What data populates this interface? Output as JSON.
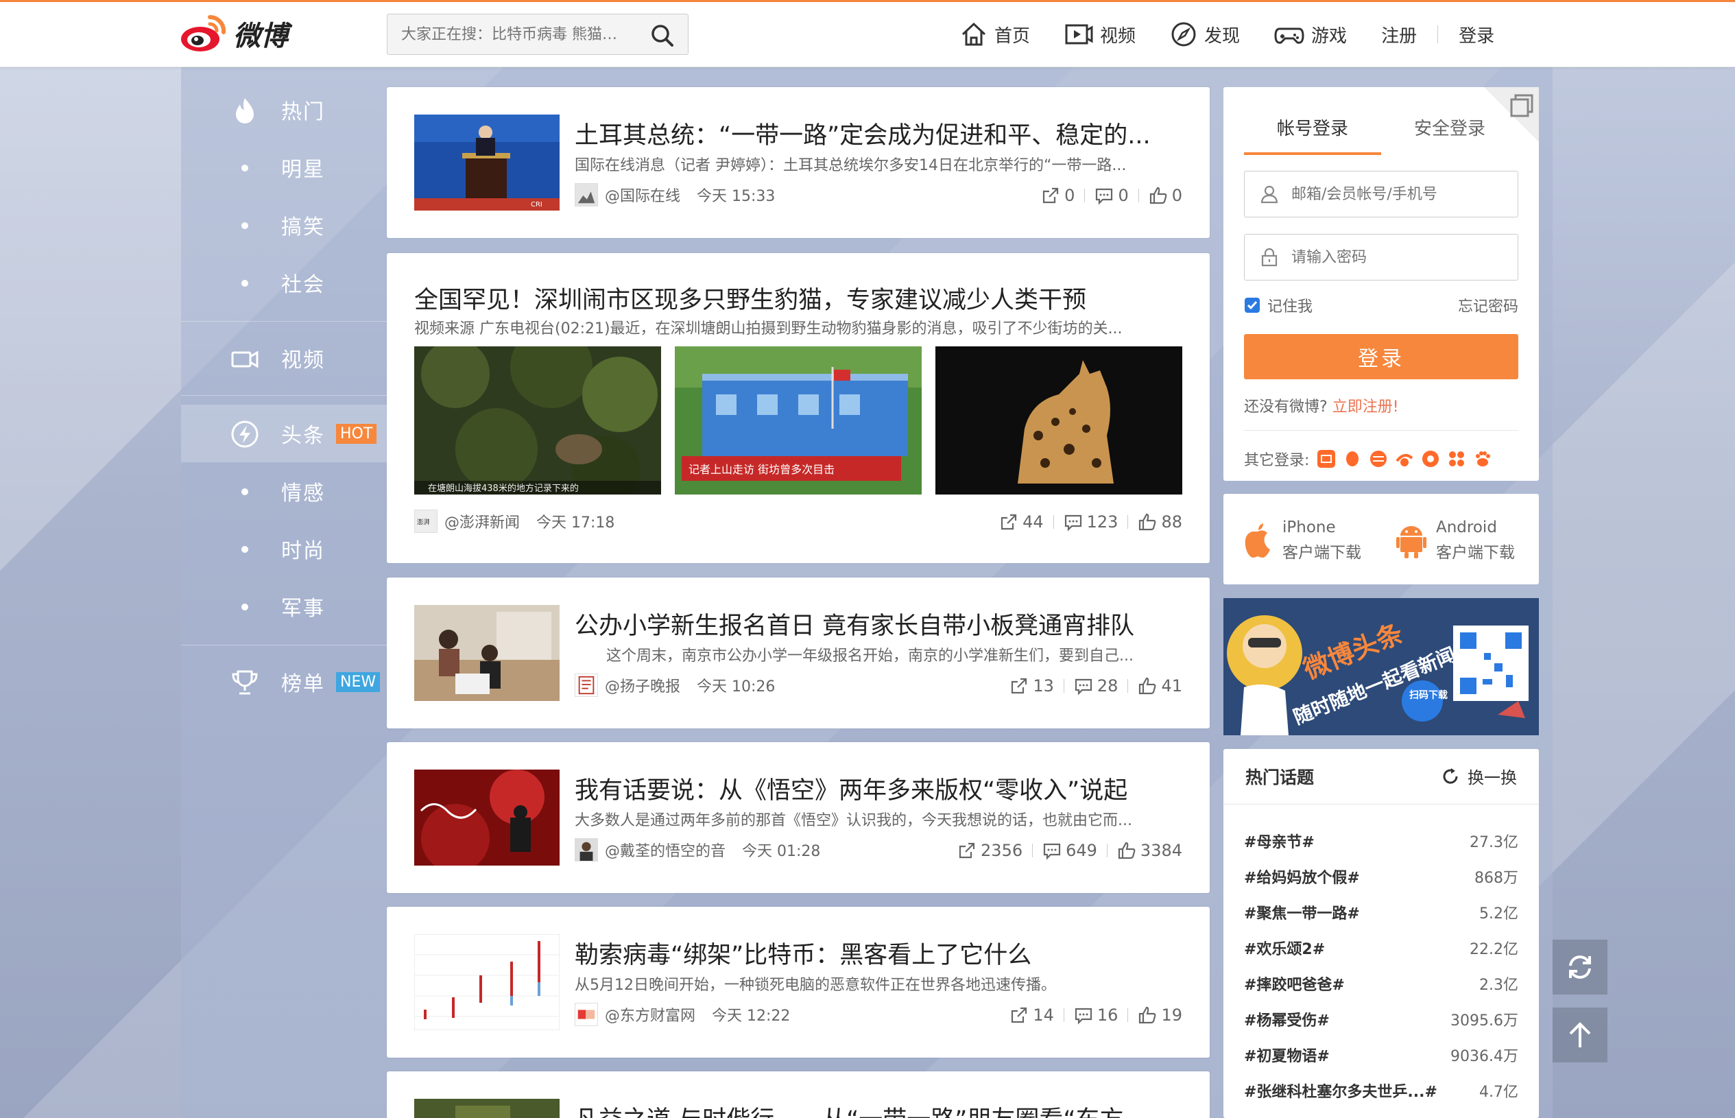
{
  "brand": {
    "name": "微博"
  },
  "search": {
    "placeholder": "大家正在搜：比特币病毒 熊猫…"
  },
  "topnav": {
    "items": [
      {
        "label": "首页",
        "icon": "home-icon"
      },
      {
        "label": "视频",
        "icon": "video-icon"
      },
      {
        "label": "发现",
        "icon": "compass-icon"
      },
      {
        "label": "游戏",
        "icon": "gamepad-icon"
      }
    ],
    "register": "注册",
    "login": "登录"
  },
  "sidebar": {
    "items": [
      {
        "label": "热门",
        "icon": "fire-icon"
      },
      {
        "label": "明星"
      },
      {
        "label": "搞笑"
      },
      {
        "label": "社会"
      },
      {
        "label": "视频",
        "icon": "video-camera-icon"
      },
      {
        "label": "头条",
        "icon": "lightning-icon",
        "badge": "HOT"
      },
      {
        "label": "情感"
      },
      {
        "label": "时尚"
      },
      {
        "label": "军事"
      },
      {
        "label": "榜单",
        "icon": "trophy-icon",
        "badge": "NEW"
      }
    ]
  },
  "feed": [
    {
      "title": "土耳其总统：“一带一路”定会成为促进和平、稳定的...",
      "summary": "国际在线消息（记者 尹婷婷）：土耳其总统埃尔多安14日在北京举行的“一带一路...",
      "source": "@国际在线",
      "time": "今天 15:33",
      "reposts": "0",
      "comments": "0",
      "likes": "0"
    },
    {
      "title": "全国罕见！深圳闹市区现多只野生豹猫，专家建议减少人类干预",
      "summary": "视频来源 广东电视台(02:21)最近，在深圳塘朗山拍摄到野生动物豹猫身影的消息，吸引了不少街坊的关...",
      "source": "@澎湃新闻",
      "time": "今天 17:18",
      "reposts": "44",
      "comments": "123",
      "likes": "88",
      "captions": [
        "在塘朗山海拔438米的地方记录下来的",
        "记者上山走访 街坊曾多次目击"
      ],
      "avatar_label": "澎湃"
    },
    {
      "title": "公办小学新生报名首日 竟有家长自带小板凳通宵排队",
      "summary": "这个周末，南京市公办小学一年级报名开始，南京的小学准新生们，要到自己...",
      "source": "@扬子晚报",
      "time": "今天 10:26",
      "reposts": "13",
      "comments": "28",
      "likes": "41"
    },
    {
      "title": "我有话要说：从《悟空》两年多来版权“零收入”说起",
      "summary": "大多数人是通过两年多前的那首《悟空》认识我的，今天我想说的话，也就由它而...",
      "source": "@戴荃的悟空的音",
      "time": "今天 01:28",
      "reposts": "2356",
      "comments": "649",
      "likes": "3384"
    },
    {
      "title": "勒索病毒“绑架”比特币：黑客看上了它什么",
      "summary": "从5月12日晚间开始，一种锁死电脑的恶意软件正在世界各地迅速传播。",
      "source": "@东方财富网",
      "time": "今天 12:22",
      "reposts": "14",
      "comments": "16",
      "likes": "19"
    },
    {
      "title": "凡益之道 与时偕行——从“一带一路”朋友圈看“东方"
    }
  ],
  "login": {
    "tab_account": "帐号登录",
    "tab_secure": "安全登录",
    "user_placeholder": "邮箱/会员帐号/手机号",
    "pass_placeholder": "请输入密码",
    "remember": "记住我",
    "forgot": "忘记密码",
    "submit": "登录",
    "no_account": "还没有微博?",
    "register_now": "立即注册!",
    "other_login": "其它登录:"
  },
  "apps": {
    "iphone_title": "iPhone",
    "iphone_sub": "客户端下载",
    "android_title": "Android",
    "android_sub": "客户端下载"
  },
  "banner": {
    "headline": "微博头条",
    "slogan": "随时随地一起看新闻!",
    "scan": "扫码下载"
  },
  "topics": {
    "title": "热门话题",
    "refresh": "换一换",
    "items": [
      {
        "name": "#母亲节#",
        "count": "27.3亿"
      },
      {
        "name": "#给妈妈放个假#",
        "count": "868万"
      },
      {
        "name": "#聚焦一带一路#",
        "count": "5.2亿"
      },
      {
        "name": "#欢乐颂2#",
        "count": "22.2亿"
      },
      {
        "name": "#摔跤吧爸爸#",
        "count": "2.3亿"
      },
      {
        "name": "#杨幂受伤#",
        "count": "3095.6万"
      },
      {
        "name": "#初夏物语#",
        "count": "9036.4万"
      },
      {
        "name": "#张继科杜塞尔多夫世乒...#",
        "count": "4.7亿"
      }
    ]
  },
  "colors": {
    "accent": "#f7873c",
    "hot": "#f7873c",
    "new": "#3fa6e0"
  }
}
